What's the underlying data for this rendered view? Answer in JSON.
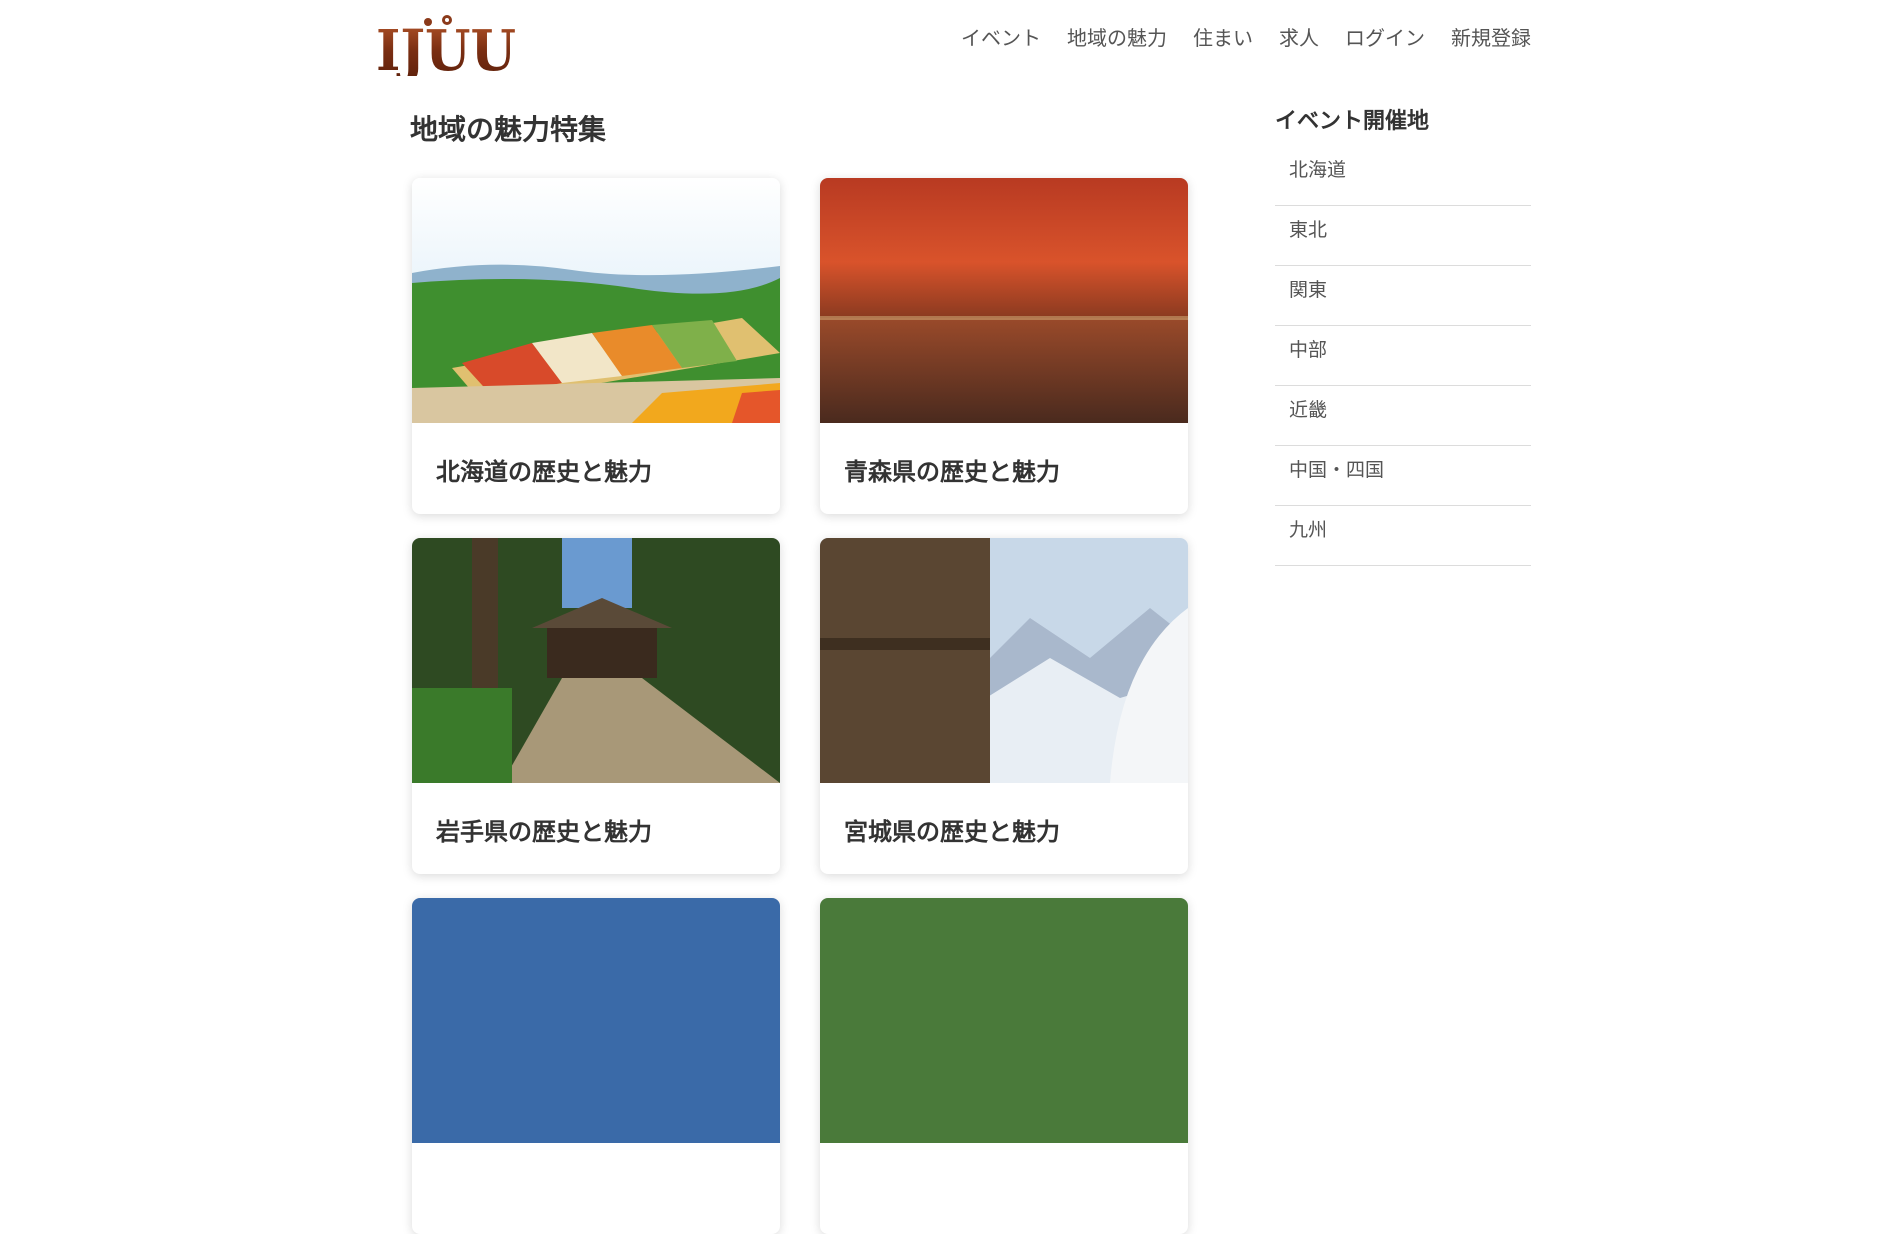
{
  "header": {
    "logo_text": "IJUU",
    "nav": [
      {
        "label": "イベント"
      },
      {
        "label": "地域の魅力"
      },
      {
        "label": "住まい"
      },
      {
        "label": "求人"
      },
      {
        "label": "ログイン"
      },
      {
        "label": "新規登録"
      }
    ]
  },
  "main": {
    "title": "地域の魅力特集",
    "cards": [
      {
        "title": "北海道の歴史と魅力",
        "image": "flower-field-image"
      },
      {
        "title": "青森県の歴史と魅力",
        "image": "autumn-forest-lake-image"
      },
      {
        "title": "岩手県の歴史と魅力",
        "image": "temple-grove-image"
      },
      {
        "title": "宮城県の歴史と魅力",
        "image": "snow-mountain-temple-image"
      }
    ]
  },
  "sidebar": {
    "title": "イベント開催地",
    "items": [
      {
        "label": "北海道"
      },
      {
        "label": "東北"
      },
      {
        "label": "関東"
      },
      {
        "label": "中部"
      },
      {
        "label": "近畿"
      },
      {
        "label": "中国・四国"
      },
      {
        "label": "九州"
      }
    ]
  },
  "colors": {
    "logo_wood": "#8b3a1a",
    "text_dark": "#333333",
    "text_nav": "#555555",
    "divider": "#dcdcdc"
  }
}
